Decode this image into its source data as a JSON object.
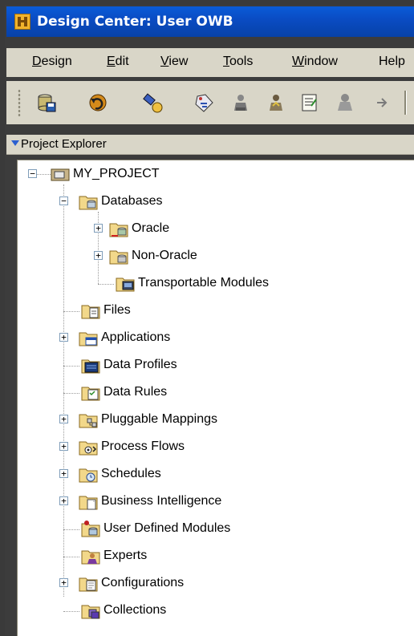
{
  "window": {
    "title": "Design Center: User OWB"
  },
  "menu": [
    {
      "label": "Design",
      "u": "D",
      "rest": "esign"
    },
    {
      "label": "Edit",
      "u": "E",
      "rest": "dit"
    },
    {
      "label": "View",
      "u": "V",
      "rest": "iew"
    },
    {
      "label": "Tools",
      "u": "T",
      "rest": "ools"
    },
    {
      "label": "Window",
      "u": "W",
      "rest": "indow"
    },
    {
      "label": "Help",
      "u": "",
      "rest": "Help"
    }
  ],
  "toolbar": {
    "buttons": [
      "database-save-icon",
      "undo-icon",
      "flashlight-icon",
      "tag-icon",
      "deploy-person-icon",
      "upload-person-icon",
      "properties-icon",
      "gray-person-icon",
      "arrow-right-icon"
    ]
  },
  "explorer": {
    "title": "Project Explorer"
  },
  "tree": {
    "root": "MY_PROJECT",
    "databases": "Databases",
    "oracle": "Oracle",
    "non_oracle": "Non-Oracle",
    "transportable": "Transportable Modules",
    "files": "Files",
    "applications": "Applications",
    "data_profiles": "Data Profiles",
    "data_rules": "Data Rules",
    "pluggable": "Pluggable Mappings",
    "process_flows": "Process Flows",
    "schedules": "Schedules",
    "bi": "Business Intelligence",
    "udm": "User Defined Modules",
    "experts": "Experts",
    "configurations": "Configurations",
    "collections": "Collections"
  }
}
